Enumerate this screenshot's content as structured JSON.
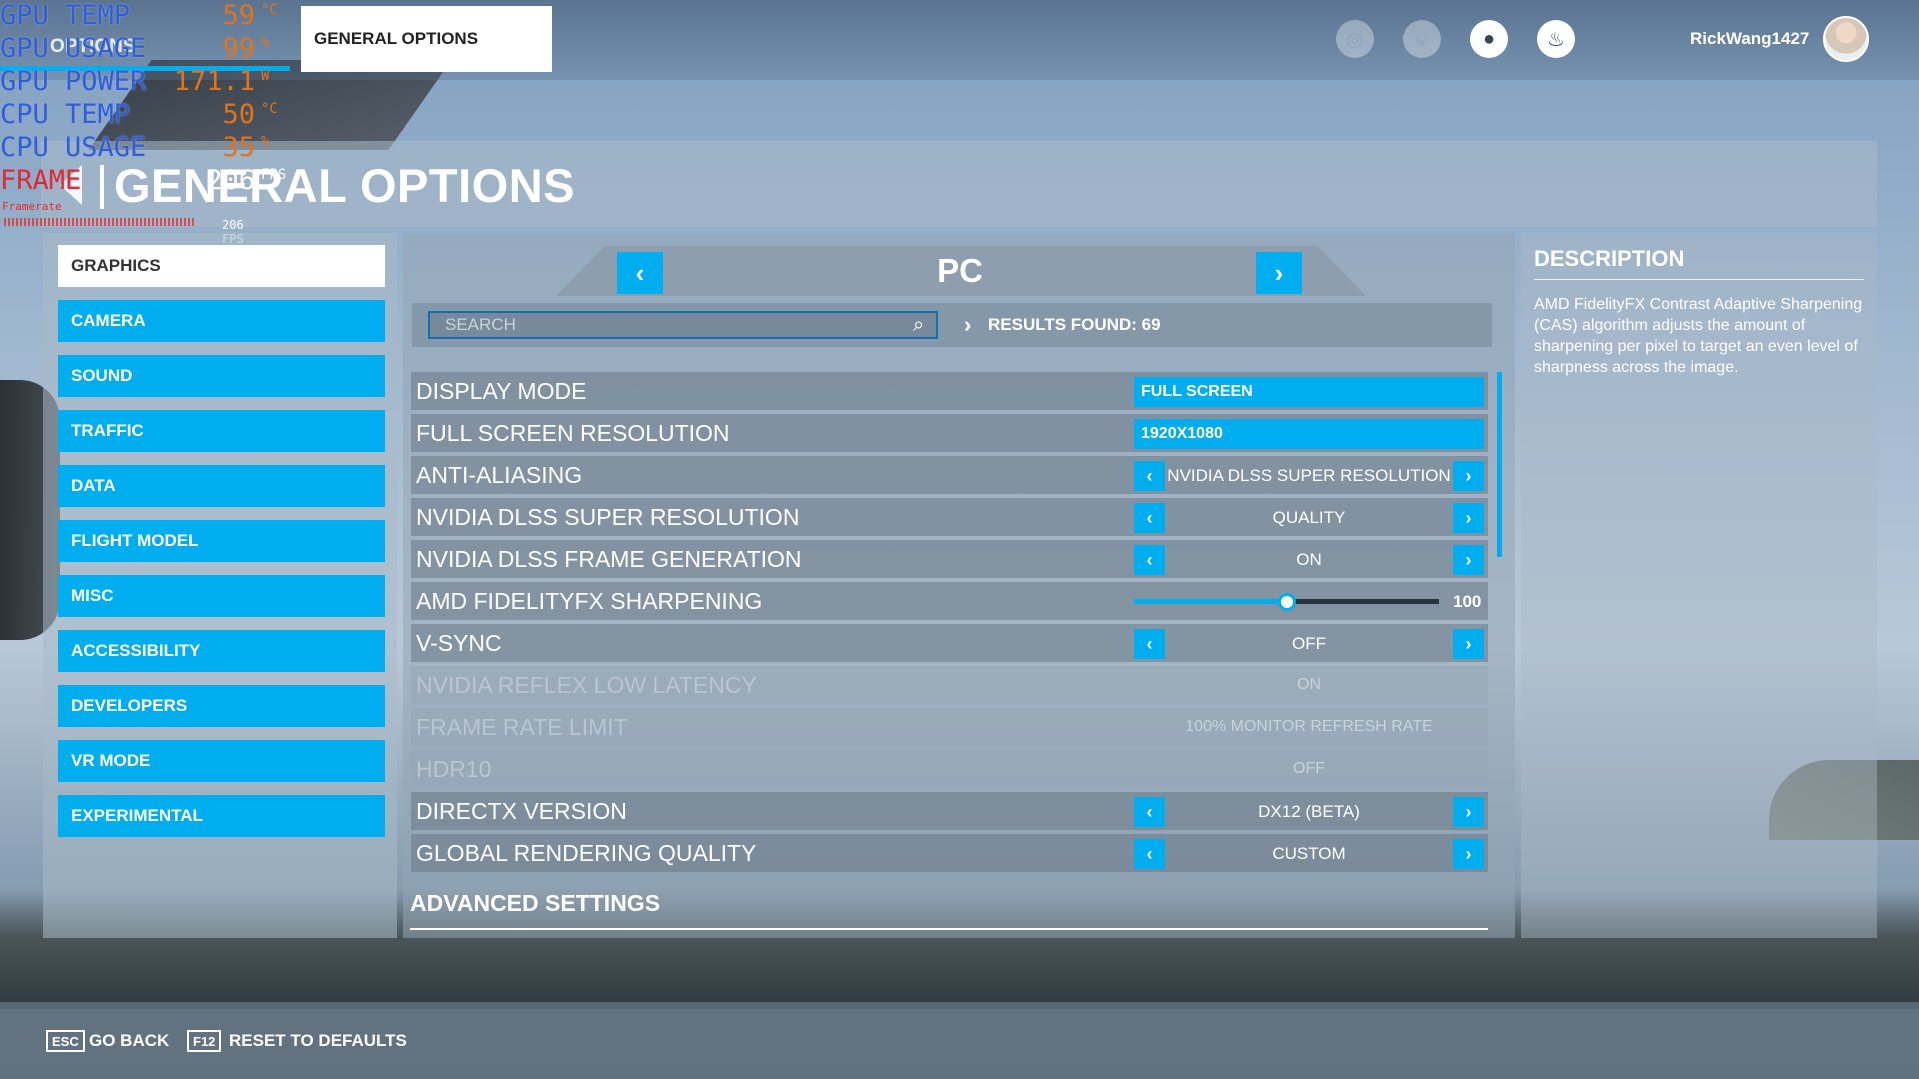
{
  "hud": {
    "gpu_temp": {
      "label": "GPU TEMP",
      "value": "59",
      "unit": "°C"
    },
    "gpu_usage": {
      "label": "GPU USAGE",
      "value": "99",
      "unit": "%"
    },
    "gpu_power": {
      "label": "GPU POWER",
      "value": "171.1",
      "unit": "W"
    },
    "cpu_temp": {
      "label": "CPU TEMP",
      "value": "50",
      "unit": "°C"
    },
    "cpu_usage": {
      "label": "CPU USAGE",
      "value": "35",
      "unit": "%"
    },
    "frame": {
      "label": "FRAME",
      "value": "206",
      "unit": "FPS"
    },
    "framerate_caption": "Framerate",
    "fps_small": "206 FPS"
  },
  "topbar": {
    "prev_tab": "OPTIONS",
    "active_tab": "GENERAL OPTIONS",
    "username": "RickWang1427"
  },
  "header": {
    "title": "GENERAL OPTIONS"
  },
  "sidebar": {
    "items": [
      {
        "label": "GRAPHICS",
        "active": true
      },
      {
        "label": "CAMERA"
      },
      {
        "label": "SOUND"
      },
      {
        "label": "TRAFFIC"
      },
      {
        "label": "DATA"
      },
      {
        "label": "FLIGHT MODEL"
      },
      {
        "label": "MISC"
      },
      {
        "label": "ACCESSIBILITY"
      },
      {
        "label": "DEVELOPERS"
      },
      {
        "label": "VR MODE"
      },
      {
        "label": "EXPERIMENTAL"
      }
    ]
  },
  "preset": {
    "label": "PC",
    "prev": "‹",
    "next": "›"
  },
  "search": {
    "placeholder": "SEARCH",
    "results": "RESULTS FOUND: 69"
  },
  "settings": [
    {
      "label": "DISPLAY MODE",
      "type": "dropdown",
      "value": "FULL SCREEN"
    },
    {
      "label": "FULL SCREEN RESOLUTION",
      "type": "dropdown",
      "value": "1920X1080"
    },
    {
      "label": "ANTI-ALIASING",
      "type": "cycle",
      "value": "NVIDIA DLSS SUPER RESOLUTION"
    },
    {
      "label": "NVIDIA DLSS SUPER RESOLUTION",
      "type": "cycle",
      "value": "QUALITY"
    },
    {
      "label": "NVIDIA DLSS FRAME GENERATION",
      "type": "cycle",
      "value": "ON"
    },
    {
      "label": "AMD FIDELITYFX SHARPENING",
      "type": "slider",
      "value": "100",
      "fraction": 0.5
    },
    {
      "label": "V-SYNC",
      "type": "cycle",
      "value": "OFF"
    },
    {
      "label": "NVIDIA REFLEX LOW LATENCY",
      "type": "disabled",
      "value": "ON"
    },
    {
      "label": "FRAME RATE LIMIT",
      "type": "disabled",
      "value": "100% MONITOR REFRESH RATE"
    },
    {
      "label": "HDR10",
      "type": "disabled",
      "value": "OFF"
    },
    {
      "label": "DIRECTX VERSION",
      "type": "cycle",
      "value": "DX12 (BETA)"
    },
    {
      "label": "GLOBAL RENDERING QUALITY",
      "type": "cycle",
      "value": "CUSTOM"
    }
  ],
  "advanced": {
    "title": "ADVANCED SETTINGS"
  },
  "description": {
    "title": "DESCRIPTION",
    "text": "AMD FidelityFX Contrast Adaptive Sharpening (CAS) algorithm adjusts the amount of sharpening per pixel to target an even level of sharpness across the image."
  },
  "footer": {
    "back_key": "ESC",
    "back_label": "GO BACK",
    "reset_key": "F12",
    "reset_label": "RESET TO DEFAULTS"
  },
  "colors": {
    "accent": "#00aeef",
    "hud_label": "#2f5fd6",
    "hud_value": "#e0741c",
    "frame_label": "#e12b2b"
  },
  "icons": [
    "activity-icon",
    "friends-icon",
    "profile-icon",
    "notifications-icon",
    "search-icon",
    "chevron-left-icon",
    "chevron-right-icon"
  ]
}
